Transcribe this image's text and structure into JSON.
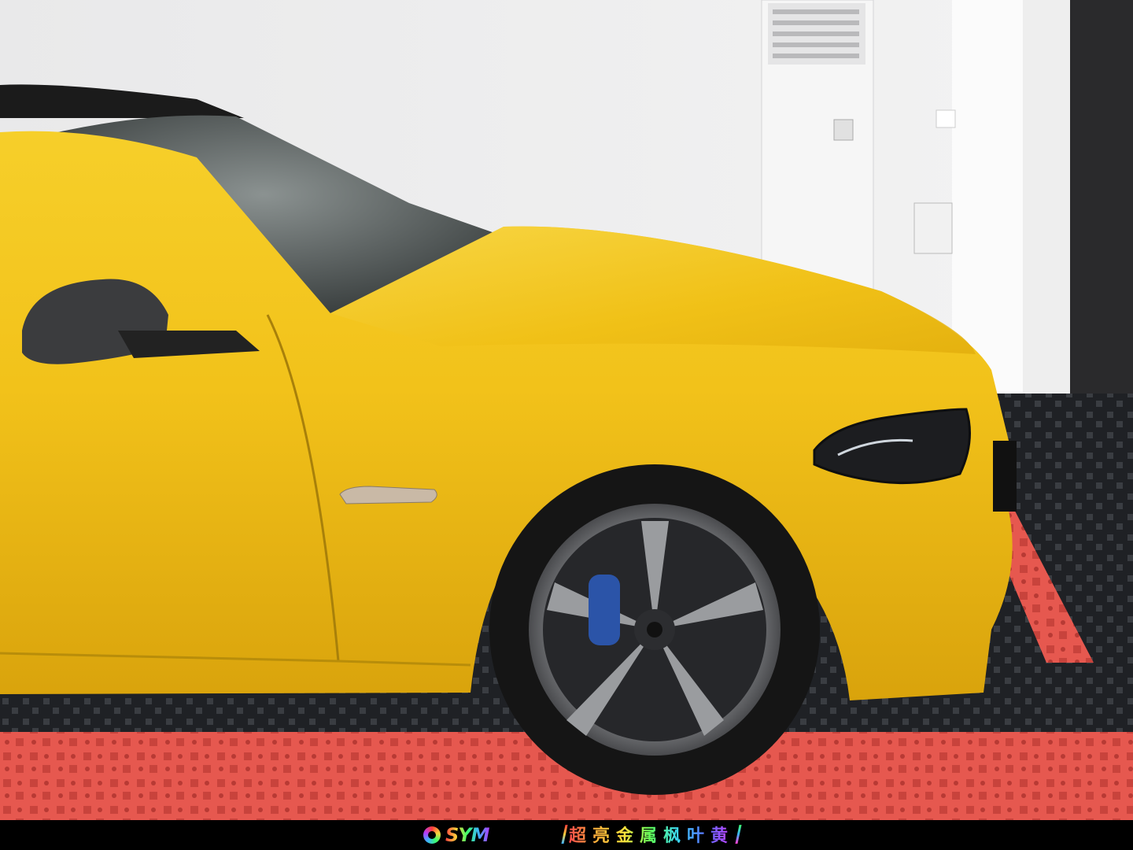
{
  "photo": {
    "subject": "car-photo",
    "car_color": "#f2c21a",
    "floor_red": "#e6584f",
    "floor_black": "#1f2125"
  },
  "banner": {
    "logo_text": "SYM",
    "caption": "超亮金属枫叶黄"
  }
}
